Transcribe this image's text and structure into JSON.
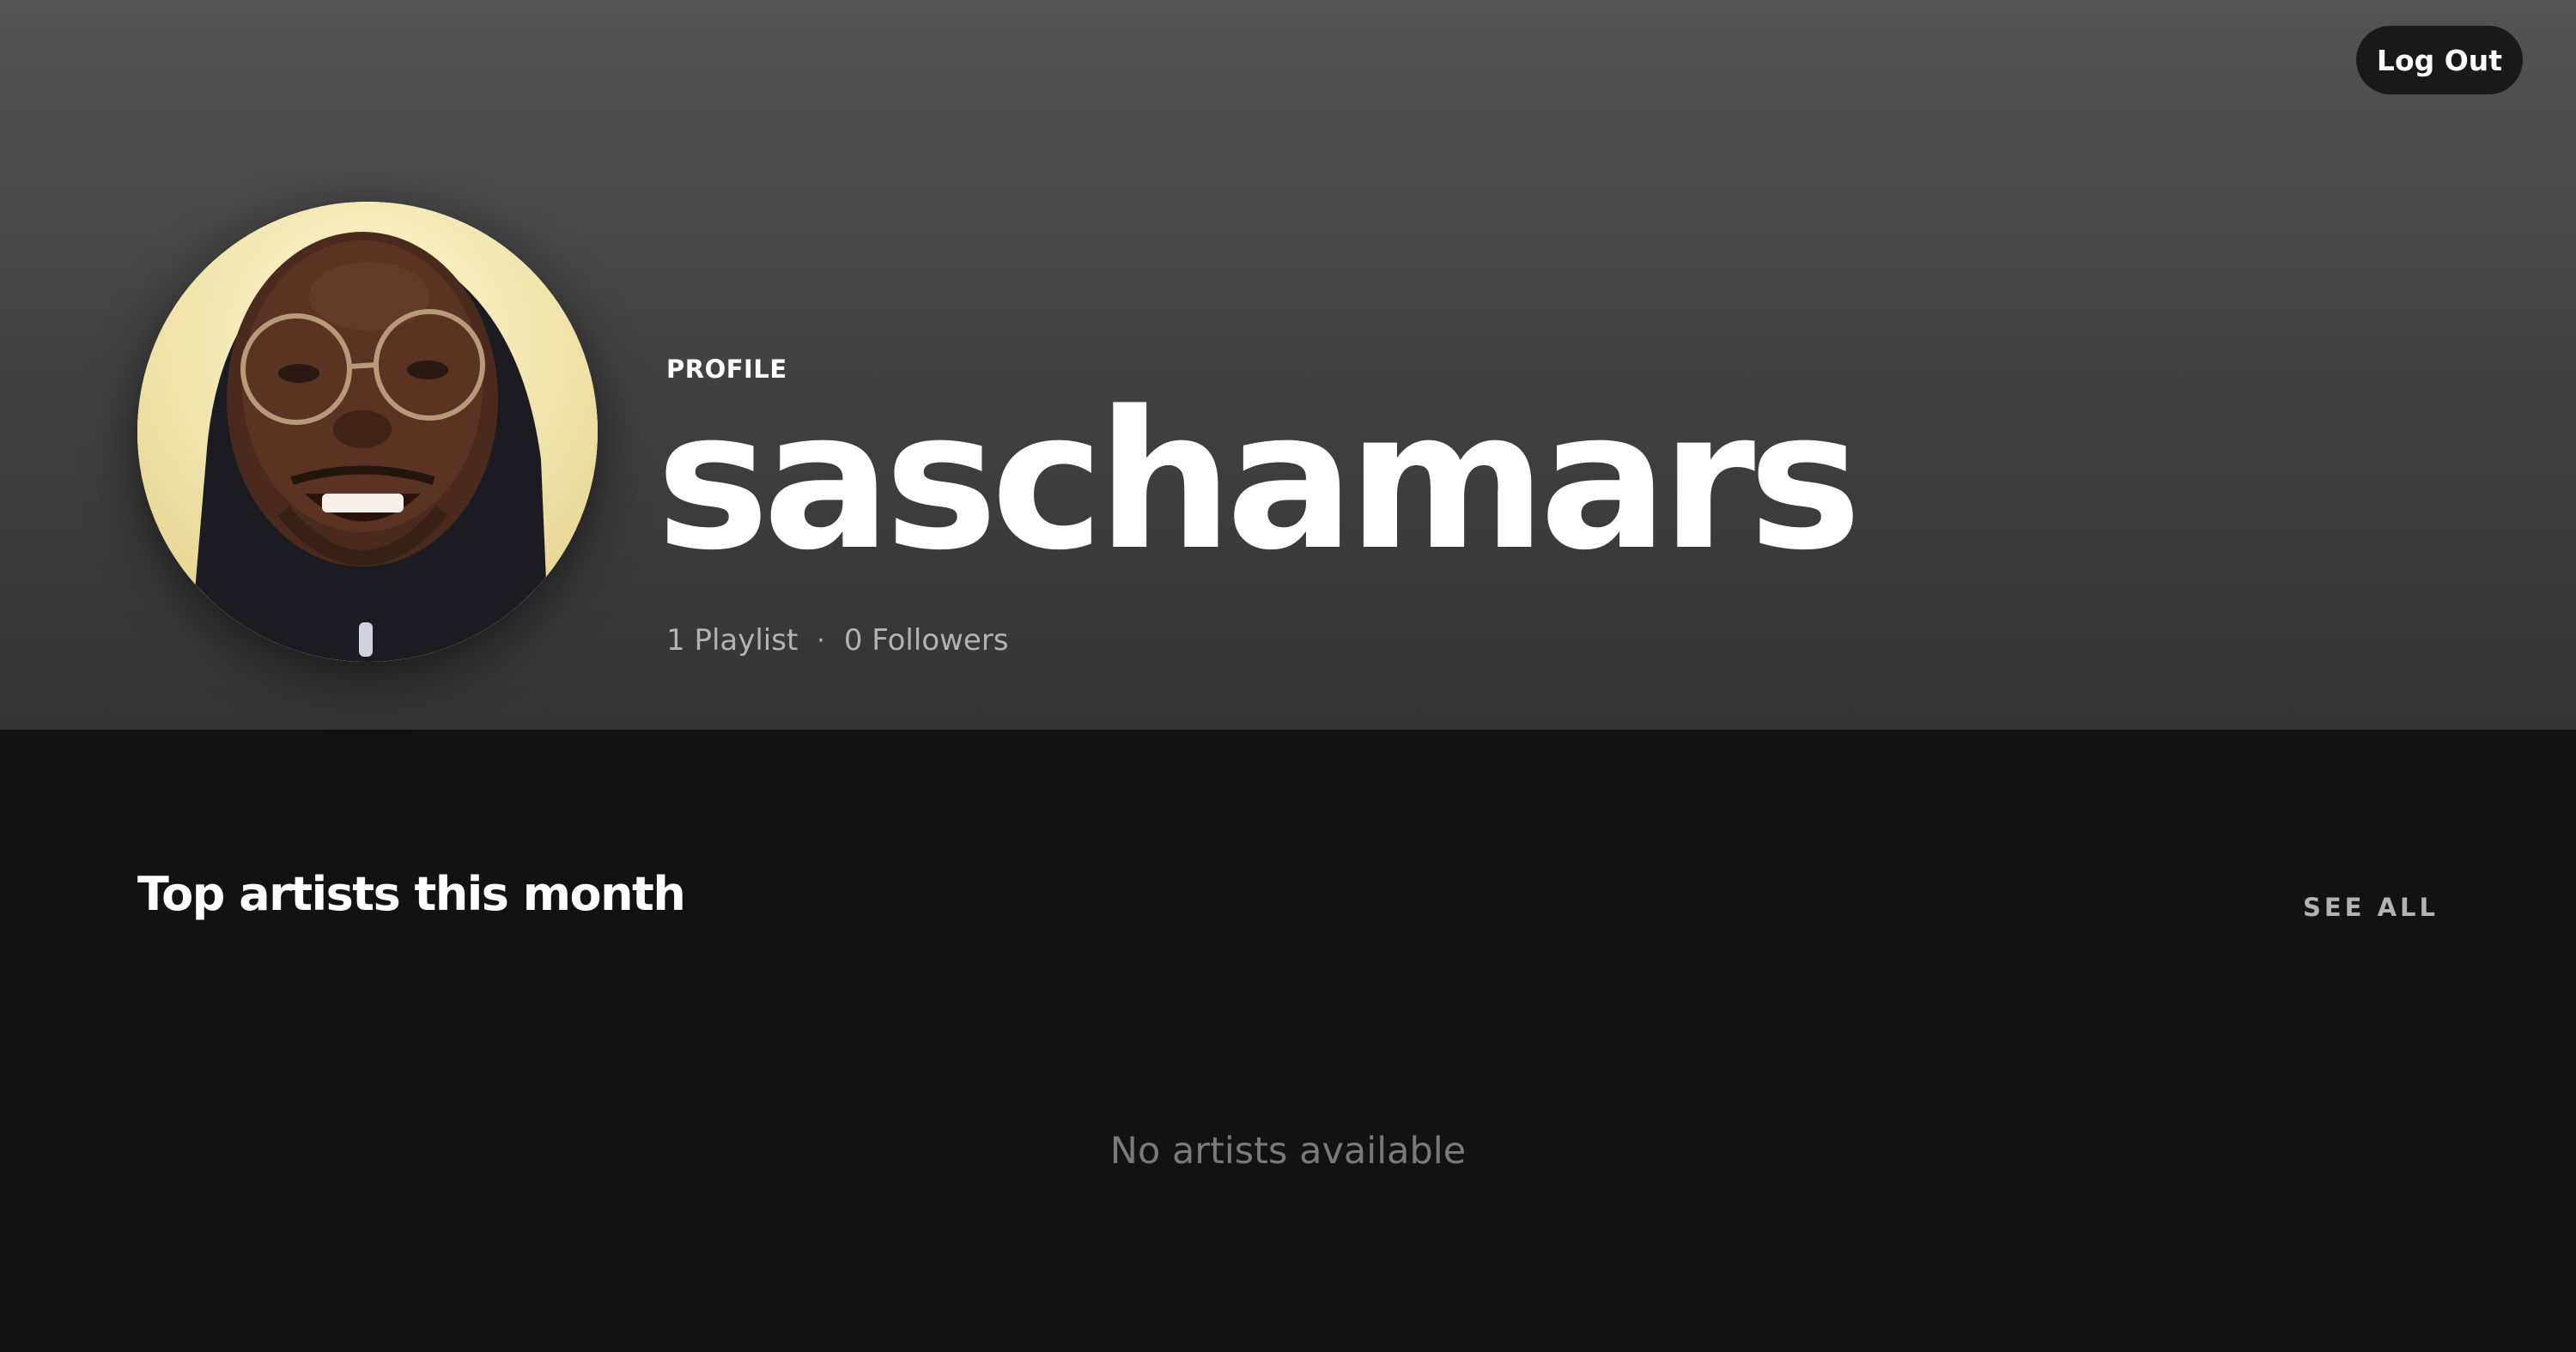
{
  "header": {
    "logout_label": "Log Out"
  },
  "profile": {
    "type_label": "PROFILE",
    "username": "saschamars",
    "playlists": "1 Playlist",
    "separator": "·",
    "followers": "0 Followers",
    "avatar_icon": "user-avatar-photo"
  },
  "top_artists": {
    "title": "Top artists this month",
    "see_all_label": "SEE ALL",
    "empty_message": "No artists available"
  },
  "colors": {
    "background": "#121212",
    "hero_top": "#545454",
    "hero_bottom": "#343434",
    "text_primary": "#ffffff",
    "text_secondary": "#b3b3b3",
    "button_bg": "#191919"
  }
}
